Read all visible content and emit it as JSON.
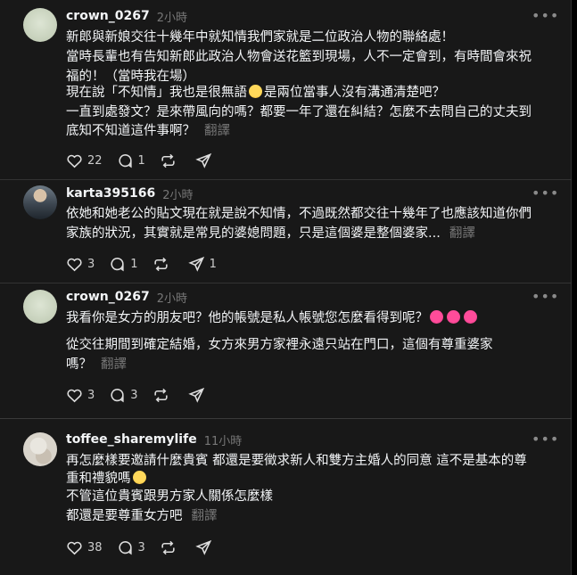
{
  "comments": [
    {
      "username": "crown_0267",
      "time": "2小時",
      "lines": [
        "新郎與新娘交往十幾年中就知情我們家就是二位政治人物的聯絡處！",
        "當時長輩也有告知新郎此政治人物會送花籃到現場，人不一定會到，有時間會來祝",
        "福的！（當時我在場）",
        "現在說「不知情」我也是很無語",
        "是兩位當事人沒有溝通清楚吧？",
        "一直到處發文？是來帶風向的嗎？都要一年了還在糾結？怎麼不去問自己的丈夫到",
        "底知不知道這件事啊？"
      ],
      "translate": "翻譯",
      "likes": "22",
      "replies": "1"
    },
    {
      "username": "karta395166",
      "time": "2小時",
      "lines": [
        "依她和她老公的貼文現在就是說不知情，不過既然都交往十幾年了也應該知道你們",
        "家族的狀況，其實就是常見的婆媳問題，只是這個婆是整個婆家..."
      ],
      "translate": "翻譯",
      "likes": "3",
      "replies": "1",
      "shares": "1"
    },
    {
      "username": "crown_0267",
      "time": "2小時",
      "lines": [
        "我看你是女方的朋友吧？他的帳號是私人帳號您怎麼看得到呢？",
        "從交往期間到確定結婚，女方來男方家裡永遠只站在門口，這個有尊重婆家",
        "嗎？"
      ],
      "translate": "翻譯",
      "likes": "3",
      "replies": "3"
    },
    {
      "username": "toffee_sharemylife",
      "time": "11小時",
      "lines": [
        "再怎麼樣要邀請什麼貴賓 都還是要徵求新人和雙方主婚人的同意 這不是基本的尊",
        "重和禮貌嗎",
        "不管這位貴賓跟男方家人關係怎麼樣",
        "都還是要尊重女方吧"
      ],
      "translate": "翻譯",
      "likes": "38",
      "replies": "3"
    }
  ],
  "icons": {
    "more": "more-horizontal-icon",
    "like": "heart-icon",
    "reply": "comment-icon",
    "repost": "repost-icon",
    "share": "send-icon"
  },
  "colors": {
    "background": "#181818",
    "text": "#f3f5f7",
    "muted": "#777777"
  }
}
